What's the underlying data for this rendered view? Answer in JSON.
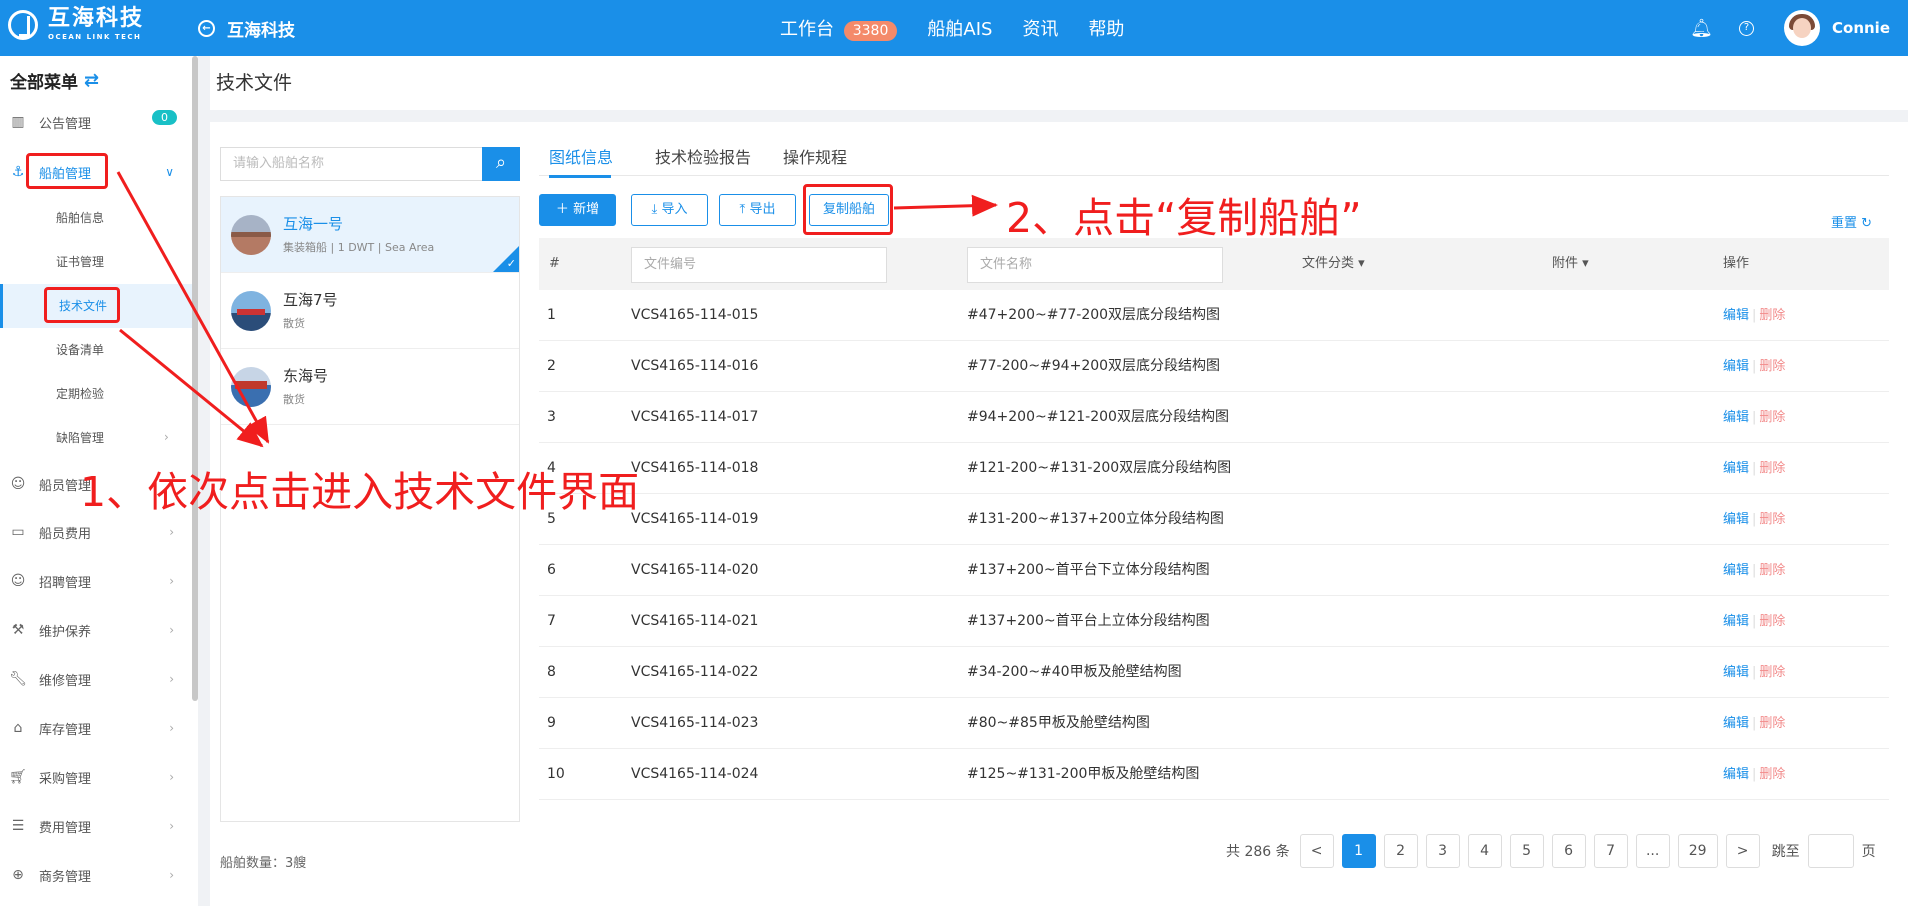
{
  "topbar": {
    "logo_cn": "互海科技",
    "logo_en": "OCEAN LINK TECH",
    "back_label": "互海科技",
    "nav": [
      {
        "label": "工作台",
        "badge": "3380"
      },
      {
        "label": "船舶AIS"
      },
      {
        "label": "资讯"
      },
      {
        "label": "帮助"
      }
    ],
    "username": "Connie",
    "help_glyph": "?",
    "colors": {
      "primary": "#1a8fe8",
      "badge": "#f48a6a"
    }
  },
  "sidebar": {
    "title": "全部菜单",
    "items": [
      {
        "label": "公告管理",
        "icon": "book-icon",
        "badge": "0"
      },
      {
        "label": "船舶管理",
        "icon": "anchor-icon",
        "expanded": true
      },
      {
        "label": "船员管理",
        "icon": "user-icon"
      },
      {
        "label": "船员费用",
        "icon": "wallet-icon"
      },
      {
        "label": "招聘管理",
        "icon": "user-search-icon"
      },
      {
        "label": "维护保养",
        "icon": "hammer-icon"
      },
      {
        "label": "维修管理",
        "icon": "wrench-icon"
      },
      {
        "label": "库存管理",
        "icon": "warehouse-icon"
      },
      {
        "label": "采购管理",
        "icon": "cart-icon"
      },
      {
        "label": "费用管理",
        "icon": "coins-icon"
      },
      {
        "label": "商务管理",
        "icon": "globe-icon"
      }
    ],
    "sub_items": [
      "船舶信息",
      "证书管理",
      "技术文件",
      "设备清单",
      "定期检验",
      "缺陷管理"
    ]
  },
  "page": {
    "title": "技术文件"
  },
  "ships": {
    "search_placeholder": "请输入船舶名称",
    "list": [
      {
        "name": "互海一号",
        "sub": "集装箱船 | 1 DWT | Sea Area",
        "selected": true
      },
      {
        "name": "互海7号",
        "sub": "散货"
      },
      {
        "name": "东海号",
        "sub": "散货"
      }
    ],
    "count_label": "船舶数量：",
    "count_value": "3艘"
  },
  "tabs": [
    "图纸信息",
    "技术检验报告",
    "操作规程"
  ],
  "toolbar": {
    "add": "新增",
    "import": "导入",
    "export": "导出",
    "copy": "复制船舶",
    "reset": "重置"
  },
  "table": {
    "columns": {
      "index": "#",
      "file_no_placeholder": "文件编号",
      "file_name_placeholder": "文件名称",
      "category": "文件分类",
      "attachment": "附件",
      "actions": "操作"
    },
    "edit_label": "编辑",
    "delete_label": "删除",
    "rows": [
      {
        "idx": "1",
        "no": "VCS4165-114-015",
        "name": "#47+200~#77-200双层底分段结构图"
      },
      {
        "idx": "2",
        "no": "VCS4165-114-016",
        "name": "#77-200~#94+200双层底分段结构图"
      },
      {
        "idx": "3",
        "no": "VCS4165-114-017",
        "name": "#94+200~#121-200双层底分段结构图"
      },
      {
        "idx": "4",
        "no": "VCS4165-114-018",
        "name": "#121-200~#131-200双层底分段结构图"
      },
      {
        "idx": "5",
        "no": "VCS4165-114-019",
        "name": "#131-200~#137+200立体分段结构图"
      },
      {
        "idx": "6",
        "no": "VCS4165-114-020",
        "name": "#137+200~首平台下立体分段结构图"
      },
      {
        "idx": "7",
        "no": "VCS4165-114-021",
        "name": "#137+200~首平台上立体分段结构图"
      },
      {
        "idx": "8",
        "no": "VCS4165-114-022",
        "name": "#34-200~#40甲板及舱壁结构图"
      },
      {
        "idx": "9",
        "no": "VCS4165-114-023",
        "name": "#80~#85甲板及舱壁结构图"
      },
      {
        "idx": "10",
        "no": "VCS4165-114-024",
        "name": "#125~#131-200甲板及舱壁结构图"
      }
    ]
  },
  "pagination": {
    "total_prefix": "共",
    "total": "286",
    "total_suffix": "条",
    "prev": "<",
    "next": ">",
    "pages": [
      "1",
      "2",
      "3",
      "4",
      "5",
      "6",
      "7",
      "...",
      "29"
    ],
    "current": "1",
    "jump_prefix": "跳至",
    "jump_suffix": "页"
  },
  "annotations": {
    "step1": "1、依次点击进入技术文件界面",
    "step2": "2、点击“复制船舶”",
    "color": "#f01e1e"
  }
}
